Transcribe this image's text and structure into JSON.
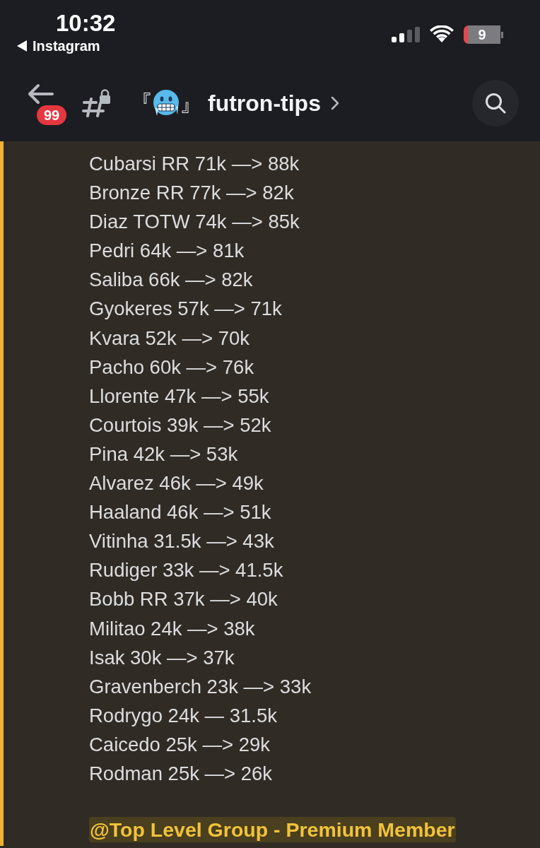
{
  "status_bar": {
    "time": "10:32",
    "back_app": "Instagram",
    "battery": "9"
  },
  "header": {
    "unread_badge": "99",
    "channel": {
      "open_bracket": "『",
      "close_bracket": "』",
      "name": "futron-tips"
    }
  },
  "message": {
    "highlighted": true,
    "lines": [
      "Cubarsi RR 71k —> 88k",
      "Bronze RR 77k —> 82k",
      "Diaz TOTW 74k —> 85k",
      "Pedri 64k —> 81k",
      "Saliba 66k —> 82k",
      "Gyokeres 57k —> 71k",
      "Kvara 52k —> 70k",
      "Pacho 60k —> 76k",
      "Llorente 47k —> 55k",
      "Courtois 39k —> 52k",
      "Pina 42k —> 53k",
      "Alvarez 46k —> 49k",
      "Haaland 46k —> 51k",
      "Vitinha 31.5k —> 43k",
      "Rudiger 33k —> 41.5k",
      "Bobb RR 37k —> 40k",
      "Militao 24k —> 38k",
      "Isak 30k —> 37k",
      "Gravenberch 23k —> 33k",
      "Rodrygo 24k — 31.5k",
      "Caicedo 25k —> 29k",
      "Rodman 25k —> 26k"
    ],
    "mention": "@Top Level Group - Premium Member"
  }
}
